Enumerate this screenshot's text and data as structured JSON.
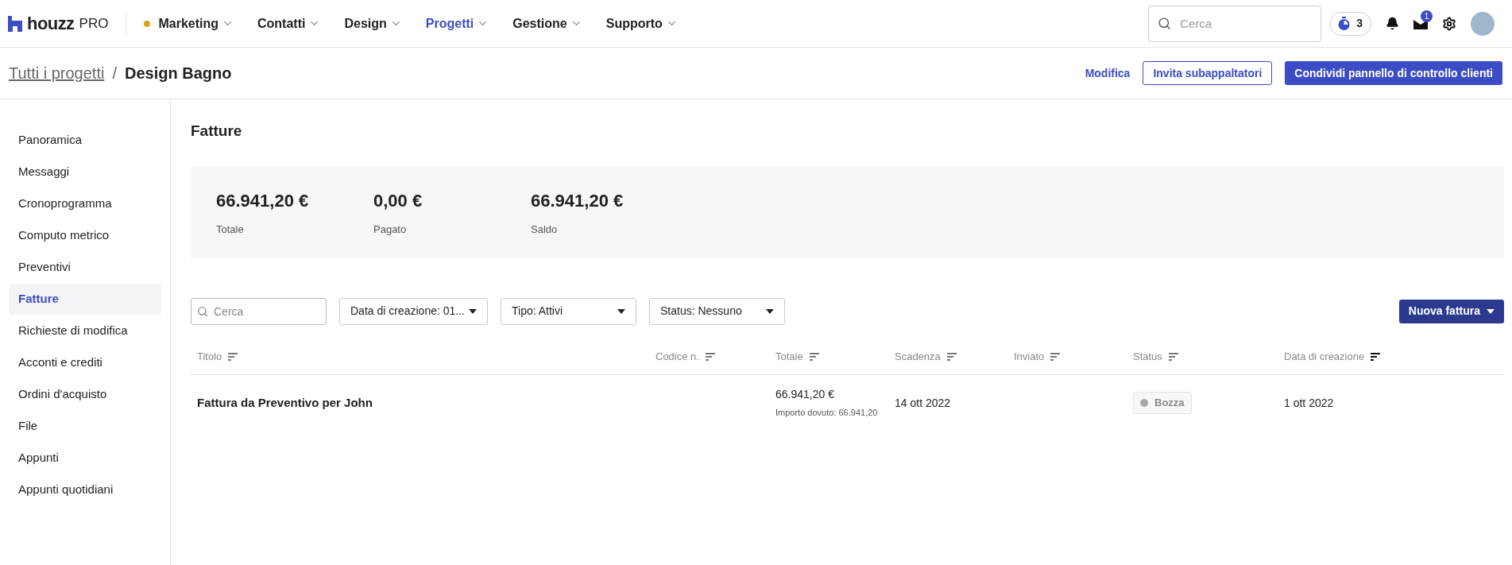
{
  "brand": {
    "name": "houzz",
    "suffix": "PRO"
  },
  "nav": [
    {
      "label": "Marketing",
      "selected": false,
      "color": "#d4a90f"
    },
    {
      "label": "Contatti",
      "selected": false
    },
    {
      "label": "Design",
      "selected": false
    },
    {
      "label": "Progetti",
      "selected": true
    },
    {
      "label": "Gestione",
      "selected": false
    },
    {
      "label": "Supporto",
      "selected": false
    }
  ],
  "search": {
    "placeholder": "Cerca"
  },
  "timer_count": "3",
  "inbox_badge": "1",
  "breadcrumb": {
    "parent": "Tutti i progetti",
    "separator": "/",
    "current": "Design Bagno"
  },
  "header_actions": {
    "edit": "Modifica",
    "invite": "Invita subappaltatori",
    "share": "Condividi pannello di controllo clienti"
  },
  "sidebar": [
    {
      "label": "Panoramica",
      "selected": false
    },
    {
      "label": "Messaggi",
      "selected": false
    },
    {
      "label": "Cronoprogramma",
      "selected": false
    },
    {
      "label": "Computo metrico",
      "selected": false
    },
    {
      "label": "Preventivi",
      "selected": false
    },
    {
      "label": "Fatture",
      "selected": true
    },
    {
      "label": "Richieste di modifica",
      "selected": false
    },
    {
      "label": "Acconti e crediti",
      "selected": false
    },
    {
      "label": "Ordini d'acquisto",
      "selected": false
    },
    {
      "label": "File",
      "selected": false
    },
    {
      "label": "Appunti",
      "selected": false
    },
    {
      "label": "Appunti quotidiani",
      "selected": false
    }
  ],
  "page_title": "Fatture",
  "summary": [
    {
      "value": "66.941,20 €",
      "label": "Totale"
    },
    {
      "value": "0,00 €",
      "label": "Pagato"
    },
    {
      "value": "66.941,20 €",
      "label": "Saldo"
    }
  ],
  "filters": {
    "search_placeholder": "Cerca",
    "dropdowns": [
      "Data di creazione: 01...",
      "Tipo: Attivi",
      "Status: Nessuno"
    ],
    "new_button": "Nuova fattura"
  },
  "table": {
    "columns": [
      {
        "label": "Titolo",
        "sorted": false
      },
      {
        "label": "Codice n.",
        "sorted": false
      },
      {
        "label": "Totale",
        "sorted": false
      },
      {
        "label": "Scadenza",
        "sorted": false
      },
      {
        "label": "Inviato",
        "sorted": false
      },
      {
        "label": "Status",
        "sorted": false
      },
      {
        "label": "Data di creazione",
        "sorted": true
      }
    ],
    "rows": [
      {
        "title": "Fattura da Preventivo per John",
        "total": "66.941,20 €",
        "due_note": "Importo dovuto: 66.941,20",
        "due_date": "14 ott 2022",
        "status": "Bozza",
        "color": "#a8a8a8",
        "created": "1 ott 2022"
      }
    ]
  }
}
